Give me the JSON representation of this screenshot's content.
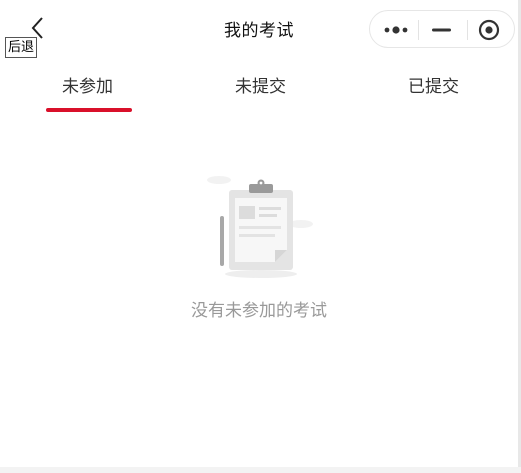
{
  "header": {
    "title": "我的考试",
    "back_tooltip": "后退",
    "back_icon": "chevron-left-icon",
    "capsule": {
      "more_icon": "more-dots-icon",
      "minimize_icon": "minimize-icon",
      "close_icon": "target-circle-icon"
    }
  },
  "tabs": [
    {
      "label": "未参加",
      "active": true
    },
    {
      "label": "未提交",
      "active": false
    },
    {
      "label": "已提交",
      "active": false
    }
  ],
  "empty_state": {
    "icon": "clipboard-icon",
    "message": "没有未参加的考试"
  },
  "colors": {
    "accent": "#d9102a",
    "empty_text": "#999999",
    "title": "#111111"
  }
}
